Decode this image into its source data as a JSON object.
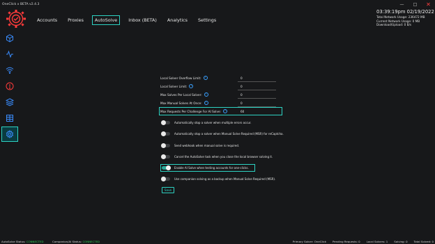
{
  "window": {
    "title": "OneClick x BETA v2.4.3",
    "minimize": "—",
    "maximize": "□",
    "close": "✕"
  },
  "nav": {
    "tabs": [
      {
        "label": "Accounts",
        "active": false
      },
      {
        "label": "Proxies",
        "active": false
      },
      {
        "label": "AutoSolve",
        "active": true
      },
      {
        "label": "Inbox (BETA)",
        "active": false
      },
      {
        "label": "Analytics",
        "active": false
      },
      {
        "label": "Settings",
        "active": false
      }
    ]
  },
  "stats": {
    "clock": "03:39:19pm 02/19/2022",
    "total_network": "Total Network Usage: 236472 MB",
    "current_network": "Current Network Usage: 0 MB",
    "download_upload": "Download/Upload: 0 B/s"
  },
  "sidebar": {
    "icons": [
      "cube-icon",
      "activity-icon",
      "wifi-icon",
      "alert-icon",
      "layers-icon",
      "table-icon",
      "gear-icon"
    ],
    "active_index": 6
  },
  "form": {
    "fields": [
      {
        "label": "Local Solver Overflow Limit:",
        "value": "0"
      },
      {
        "label": "Local Solver Limit:",
        "value": "0"
      },
      {
        "label": "Max Solves Per Local Solver:",
        "value": "0"
      },
      {
        "label": "Max Manual Solves At Once:",
        "value": "0"
      },
      {
        "label": "Max Requests Per Challenge For AI Solve:",
        "value": "60",
        "highlighted": true
      }
    ],
    "toggles": [
      {
        "label": "Automatically stop a solver when multiple errors occur.",
        "on": false
      },
      {
        "label": "Automatically stop a solver when Manual Solve Required (MSR) for reCaptcha.",
        "on": false
      },
      {
        "label": "Send webhook when manual solve is required.",
        "on": false
      },
      {
        "label": "Cancel the AutoSolve task when you close the local browser solving it.",
        "on": false
      },
      {
        "label": "Enable AI Solve when testing accounts for one-clicks.",
        "on": true,
        "highlighted": true
      },
      {
        "label": "Use companion solving as a backup when Manual Solve Required (MSR).",
        "on": false
      }
    ],
    "save_label": "Save"
  },
  "status": {
    "autosolve_label": "AutoSolve Status:",
    "autosolve_value": "CONNECTED",
    "companion_label": "Companion/AI Status:",
    "companion_value": "CONNECTED",
    "primary_solver": "Primary Solver: OneClick",
    "pending": "Pending Requests: 0",
    "local_solvers": "Local Solvers: 1",
    "solving": "Solving: 0",
    "total_solved": "Total Solved: 0"
  },
  "colors": {
    "accent": "#2dd4c4",
    "connected": "#2fd35b",
    "danger": "#ff4040",
    "background": "#17181a"
  }
}
